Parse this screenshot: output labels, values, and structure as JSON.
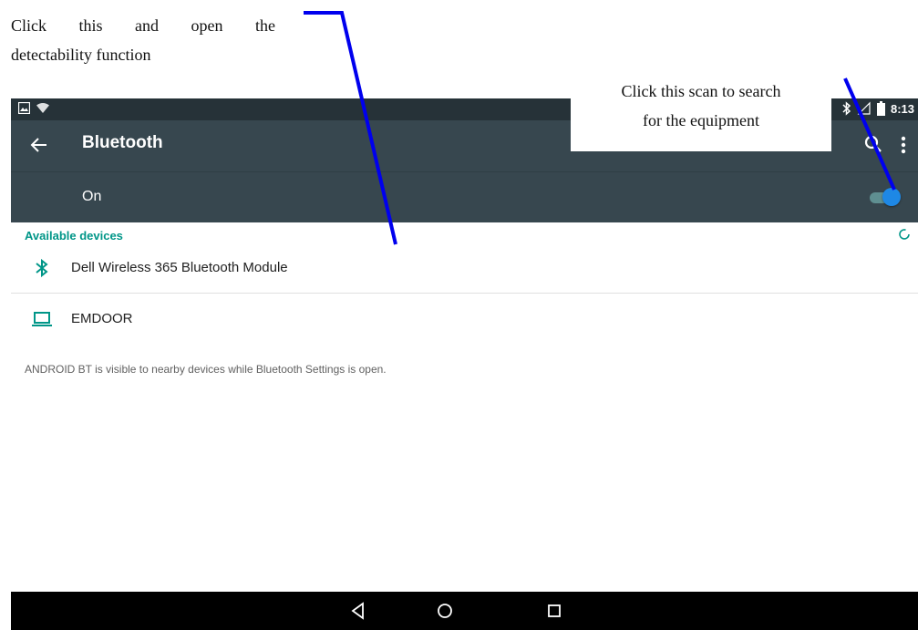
{
  "annotations": {
    "left_line1_words": [
      "Click",
      "this",
      "and",
      "open",
      "the"
    ],
    "left_line2": "detectability function",
    "right_line1": "Click this scan to search",
    "right_line2": "for the equipment"
  },
  "status_bar": {
    "time": "8:13",
    "icons": [
      "image-icon",
      "wifi-icon",
      "bluetooth-icon",
      "signal-icon",
      "battery-icon"
    ]
  },
  "app_bar": {
    "title": "Bluetooth",
    "icons": [
      "back-arrow-icon",
      "search-icon",
      "more-vert-icon"
    ]
  },
  "bluetooth_toggle": {
    "label": "On",
    "state": "on"
  },
  "available_devices": {
    "header": "Available devices",
    "items": [
      {
        "name": "Dell Wireless 365 Bluetooth Module",
        "icon": "bluetooth-icon"
      },
      {
        "name": "EMDOOR",
        "icon": "laptop-icon"
      }
    ]
  },
  "footer": {
    "visibility_text": "ANDROID BT is visible to nearby devices while Bluetooth Settings is open."
  },
  "nav_bar": {
    "icons": [
      "nav-back-icon",
      "nav-home-icon",
      "nav-recents-icon"
    ]
  },
  "colors": {
    "status_bar": "#263238",
    "app_bar": "#37474f",
    "accent": "#009688",
    "toggle_knob": "#1e88e5",
    "annotation_line": "#0000ee"
  }
}
